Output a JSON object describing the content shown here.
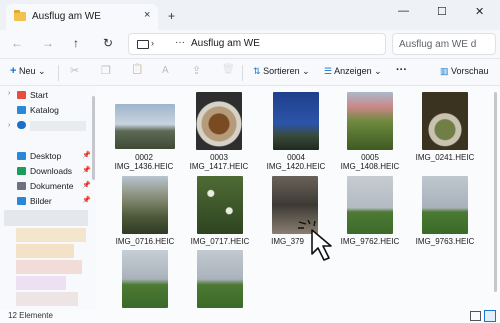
{
  "window": {
    "tab_title": "Ausflug am WE",
    "tab_close": "×",
    "new_tab": "+",
    "minimize": "—",
    "maximize": "☐",
    "close": "✕"
  },
  "nav": {
    "back": "←",
    "forward": "→",
    "up": "↑",
    "refresh": "↻",
    "address_sep": "›",
    "address_more": "···",
    "address_chevron": "›",
    "address_path": "Ausflug am WE",
    "search_placeholder": "Ausflug am WE d"
  },
  "toolbar": {
    "new_label": "Neu",
    "new_plus": "+",
    "cut": "✂",
    "copy": "❐",
    "paste": "📋",
    "rename": "A",
    "share": "⇪",
    "delete": "🗑",
    "sort_label": "Sortieren",
    "view_label": "Anzeigen",
    "more": "···",
    "preview_label": "Vorschau",
    "dropdown": "⌄"
  },
  "sidebar": {
    "items": [
      {
        "label": "Start",
        "icon": "home-icon",
        "color": "#e84c3d"
      },
      {
        "label": "Katalog",
        "icon": "gallery-icon",
        "color": "#2b88d8"
      },
      {
        "label": "",
        "icon": "onedrive-icon",
        "color": "#1e6fc7"
      },
      {
        "label": "Desktop",
        "icon": "desktop-icon",
        "color": "#2b88d8"
      },
      {
        "label": "Downloads",
        "icon": "download-icon",
        "color": "#1b9e5a"
      },
      {
        "label": "Dokumente",
        "icon": "document-icon",
        "color": "#6b7280"
      },
      {
        "label": "Bilder",
        "icon": "pictures-icon",
        "color": "#2b88d8"
      }
    ],
    "pin": "📌",
    "chevron": "›"
  },
  "files": [
    {
      "top": "0002",
      "name": "IMG_1436.HEIC"
    },
    {
      "top": "0003",
      "name": "IMG_1417.HEIC"
    },
    {
      "top": "0004",
      "name": "IMG_1420.HEIC"
    },
    {
      "top": "0005",
      "name": "IMG_1408.HEIC"
    },
    {
      "top": "",
      "name": "IMG_0241.HEIC"
    },
    {
      "top": "",
      "name": "IMG_0716.HEIC"
    },
    {
      "top": "",
      "name": "IMG_0717.HEIC"
    },
    {
      "top": "",
      "name": "IMG_379"
    },
    {
      "top": "",
      "name": "IMG_9762.HEIC"
    },
    {
      "top": "",
      "name": "IMG_9763.HEIC"
    },
    {
      "top": "",
      "name": ""
    },
    {
      "top": "",
      "name": ""
    }
  ],
  "status": {
    "count": "12 Elemente"
  },
  "colors": {
    "accent": "#1a73c8",
    "folder": "#f2c14e"
  }
}
